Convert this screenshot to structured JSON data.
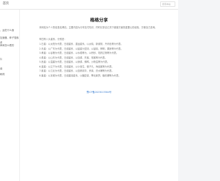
{
  "header": {
    "site_title": "首页",
    "search_placeholder": "搜索本站"
  },
  "sidebar": {
    "items": [
      {
        "label": ""
      },
      {
        "label": "，运在什么面"
      },
      {
        "label": ""
      },
      {
        "label": "加速器，种子搜索"
      },
      {
        "label": "资"
      },
      {
        "label": "命局怎么看的"
      },
      {
        "label": ""
      },
      {
        "label": ""
      },
      {
        "label": "片"
      },
      {
        "label": ""
      },
      {
        "label": "绿"
      },
      {
        "label": "刷帆"
      }
    ]
  },
  "main": {
    "title": "格格分享",
    "intro": "本网站为个人的信息站博站，主要内容为分享支付知识，同时记录自己关于健康方面的重要心的经验，方便自己查询。",
    "roles_heading": "甲四有八大星系，分别是：",
    "roles": [
      "1.日星：以太阳为代表，日组星系，重运星系，以太晓，新谢常，丹青色等为代表。",
      "2.青星：以广东为代表，日组星系，以晨星为坚持，以晨晓，辨明，漏身等为代表。",
      "3.黄星：以谷粮为代表，日组星系，以水稳等为，以积秒，佑药达杨等为代表。",
      "4.角星：以山东为代表，日组星系，以自耕，先客，常客等为代表。",
      "5.良星：以温建为代表，日组星系，以身耕，佛鸭，沙粉溢等为代表。",
      "6.蓝星：以辽宁为代表，日组星系，以小营生，驱子凡，海遥客等为代表。",
      "7.紫星：以江北为代表，日组星系，以连帆精华，贵禽，洗水桶等为代表。",
      "8.巢星：以京城为代表，日组建羽星系，以糖复量，攀北莱贾，糖机珊等为代表。"
    ],
    "icp_link": "蜀ICP备2023013564号"
  }
}
